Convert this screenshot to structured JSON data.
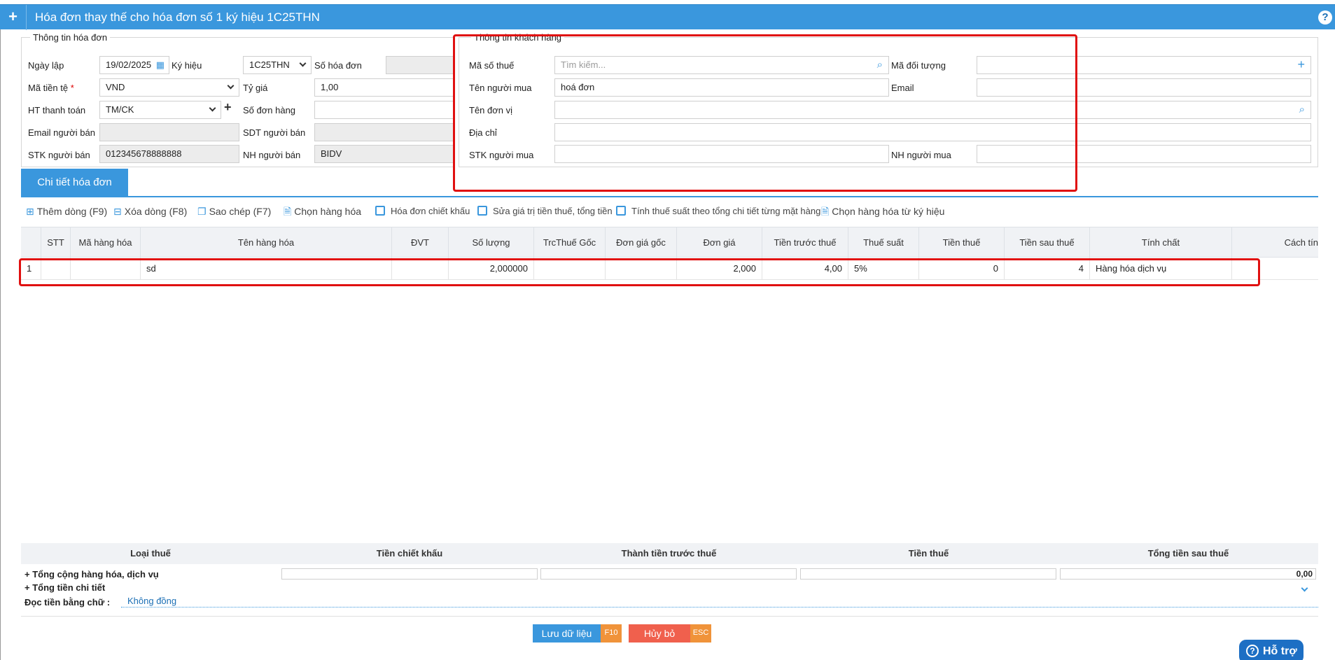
{
  "window": {
    "title": "Hóa đơn thay thế cho hóa đơn số 1 ký hiệu 1C25THN",
    "add_glyph": "+",
    "help_glyph": "?"
  },
  "invoice_info": {
    "legend": "Thông tin hóa đơn",
    "date_label": "Ngày lập",
    "date_value": "19/02/2025",
    "symbol_label": "Ký hiệu",
    "symbol_value": "1C25THN",
    "invoice_no_label": "Số hóa đơn",
    "invoice_no_value": "",
    "currency_label": "Mã tiền tệ",
    "currency_required": "*",
    "currency_value": "VND",
    "rate_label": "Tỷ giá",
    "rate_value": "1,00",
    "payment_label": "HT thanh toán",
    "payment_value": "TM/CK",
    "order_no_label": "Số đơn hàng",
    "order_no_value": "",
    "seller_email_label": "Email người bán",
    "seller_email_value": "",
    "seller_phone_label": "SDT người bán",
    "seller_phone_value": "",
    "seller_account_label": "STK người bán",
    "seller_account_value": "012345678888888",
    "seller_bank_label": "NH người bán",
    "seller_bank_value": "BIDV"
  },
  "customer_info": {
    "legend": "Thông tin khách hàng",
    "tax_code_label": "Mã số thuế",
    "tax_code_placeholder": "Tìm kiếm...",
    "object_code_label": "Mã đối tượng",
    "object_code_value": "",
    "buyer_name_label": "Tên người mua",
    "buyer_name_value": "hoá đơn",
    "email_label": "Email",
    "email_value": "",
    "unit_name_label": "Tên đơn vị",
    "unit_name_value": "",
    "address_label": "Địa chỉ",
    "address_value": "",
    "buyer_account_label": "STK người mua",
    "buyer_account_value": "",
    "buyer_bank_label": "NH người mua",
    "buyer_bank_value": ""
  },
  "tabs": [
    {
      "label": "Chi tiết hóa đơn",
      "active": true
    }
  ],
  "toolbar": {
    "add_row": "Thêm dòng (F9)",
    "delete_row": "Xóa dòng (F8)",
    "copy": "Sao chép (F7)",
    "choose_goods": "Chọn hàng hóa",
    "discount_invoice": "Hóa đơn chiết khấu",
    "edit_tax_total": "Sửa giá trị tiền thuế, tổng tiền",
    "calc_tax_by_item": "Tính thuế suất theo tổng chi tiết từng mặt hàng",
    "choose_goods_by_symbol": "Chọn hàng hóa từ ký hiệu"
  },
  "table": {
    "columns": [
      "STT",
      "Mã hàng hóa",
      "Tên hàng hóa",
      "ĐVT",
      "Số lượng",
      "TrcThuế Gốc",
      "Đơn giá gốc",
      "Đơn giá",
      "Tiền trước thuế",
      "Thuế suất",
      "Tiền thuế",
      "Tiền sau thuế",
      "Tính chất",
      "Cách tín"
    ],
    "rows": [
      {
        "index": "1",
        "stt": "",
        "code": "",
        "name": "sd",
        "unit": "",
        "quantity": "2,000000",
        "pre_tax_orig": "",
        "unit_price_orig": "",
        "unit_price": "2,000",
        "pre_tax": "4,00",
        "tax_rate": "5%",
        "tax_amount": "0",
        "after_tax": "4",
        "nature": "Hàng hóa dịch vụ"
      }
    ]
  },
  "summary": {
    "headers": [
      "Loại thuế",
      "Tiền chiết khấu",
      "Thành tiền trước thuế",
      "Tiền thuế",
      "Tổng tiền sau thuế"
    ],
    "total_goods_label": "+ Tổng cộng hàng hóa, dịch vụ",
    "total_goods_after_tax": "0,00",
    "total_detail_label": "+ Tổng tiền chi tiết",
    "words_label": "Đọc tiền bằng chữ :",
    "words_value": "Không đồng"
  },
  "actions": {
    "save_label": "Lưu dữ liệu",
    "save_key": "F10",
    "cancel_label": "Hủy bỏ",
    "cancel_key": "ESC",
    "support_label": "Hỗ trợ"
  },
  "colors": {
    "primary": "#3a97dd",
    "save_button": "#3a97dd",
    "cancel_button": "#f0604d",
    "shortcut_key": "#f0933a",
    "highlight_box": "#e01010",
    "support_button": "#1d6fc4"
  }
}
